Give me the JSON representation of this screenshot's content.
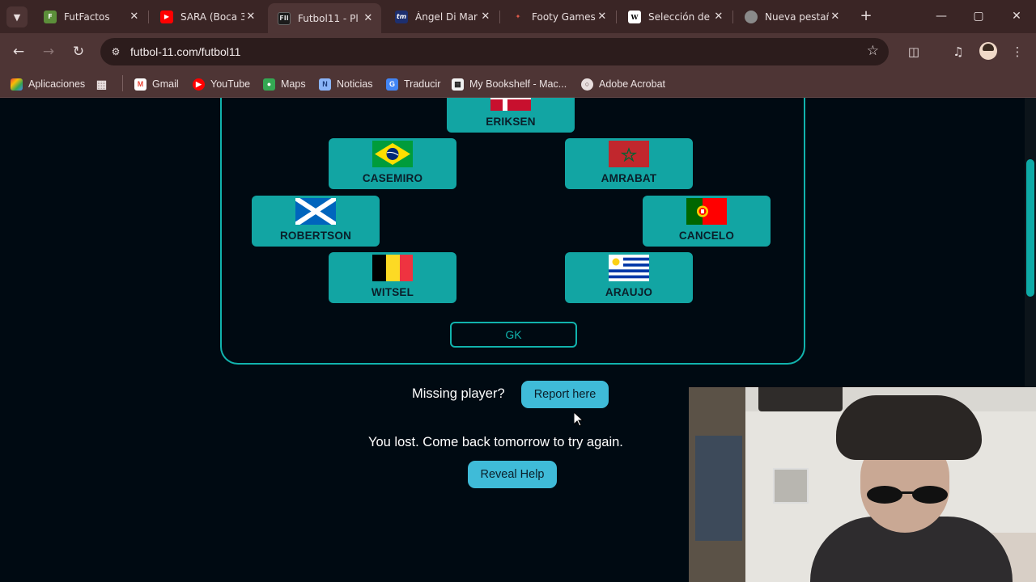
{
  "browser": {
    "tabs": [
      {
        "title": "FutFactos",
        "favicon": "futfactos-icon",
        "color": "#5c8f3a",
        "active": false
      },
      {
        "title": "SARA (Boca 3",
        "favicon": "youtube-icon",
        "color": "#ff0000",
        "active": false
      },
      {
        "title": "Futbol11 - Pl",
        "favicon": "futbol11-icon",
        "color": "#1b1b1b",
        "active": true
      },
      {
        "title": "Ángel Di Mar",
        "favicon": "transfermarkt-icon",
        "color": "#1d2f6f",
        "active": false
      },
      {
        "title": "Footy Games",
        "favicon": "footy-games-icon",
        "color": "#c0392b",
        "active": false
      },
      {
        "title": "Selección de",
        "favicon": "wikipedia-icon",
        "color": "#ffffff",
        "active": false
      },
      {
        "title": "Nueva pestaña",
        "favicon": "chrome-icon",
        "color": "#8a8a8a",
        "active": false
      }
    ],
    "url": "futbol-11.com/futbol11",
    "bookmarks": [
      {
        "label": "Aplicaciones",
        "icon": "apps-grid-icon"
      },
      {
        "label": "Gmail",
        "icon": "gmail-icon"
      },
      {
        "label": "YouTube",
        "icon": "youtube-icon"
      },
      {
        "label": "Maps",
        "icon": "maps-icon"
      },
      {
        "label": "Noticias",
        "icon": "news-icon"
      },
      {
        "label": "Traducir",
        "icon": "translate-icon"
      },
      {
        "label": "My Bookshelf - Mac...",
        "icon": "bookshelf-icon"
      },
      {
        "label": "Adobe Acrobat",
        "icon": "acrobat-icon"
      }
    ]
  },
  "formation": {
    "players": [
      {
        "name": "ERIKSEN",
        "country": "denmark"
      },
      {
        "name": "CASEMIRO",
        "country": "brazil"
      },
      {
        "name": "AMRABAT",
        "country": "morocco"
      },
      {
        "name": "ROBERTSON",
        "country": "scotland"
      },
      {
        "name": "CANCELO",
        "country": "portugal"
      },
      {
        "name": "WITSEL",
        "country": "belgium"
      },
      {
        "name": "ARAUJO",
        "country": "uruguay"
      }
    ],
    "gk_label": "GK"
  },
  "footer": {
    "missing_text": "Missing player?",
    "report_label": "Report here",
    "lost_text": "You lost. Come back tomorrow to try again.",
    "reveal_label": "Reveal Help"
  },
  "colors": {
    "card": "#12a5a3",
    "accent": "#11b3ad",
    "button": "#3fbbd8",
    "background": "#000a12"
  }
}
